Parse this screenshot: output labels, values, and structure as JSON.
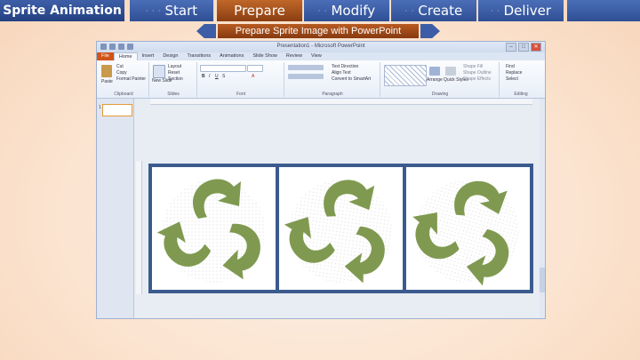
{
  "nav": {
    "title": "Sprite Animation",
    "tabs": [
      {
        "label": "Start",
        "active": false
      },
      {
        "label": "Prepare",
        "active": true
      },
      {
        "label": "Modify",
        "active": false
      },
      {
        "label": "Create",
        "active": false
      },
      {
        "label": "Deliver",
        "active": false
      }
    ]
  },
  "subtitle": "Prepare Sprite Image with PowerPoint",
  "ppt": {
    "window_title": "Presentation1 - Microsoft PowerPoint",
    "ribbon_tabs": [
      "File",
      "Home",
      "Insert",
      "Design",
      "Transitions",
      "Animations",
      "Slide Show",
      "Review",
      "View"
    ],
    "clipboard": {
      "paste": "Paste",
      "cut": "Cut",
      "copy": "Copy",
      "format_painter": "Format Painter",
      "group": "Clipboard"
    },
    "slides": {
      "new_slide": "New Slide",
      "layout": "Layout",
      "reset": "Reset",
      "section": "Section",
      "group": "Slides"
    },
    "groups": {
      "font": "Font",
      "paragraph": "Paragraph",
      "drawing": "Drawing",
      "editing": "Editing"
    },
    "paragraph_items": [
      "Text Direction",
      "Align Text",
      "Convert to SmartArt"
    ],
    "drawing_items": [
      "Arrange",
      "Quick Styles",
      "Shape Fill",
      "Shape Outline",
      "Shape Effects"
    ],
    "editing_items": [
      "Find",
      "Replace",
      "Select"
    ],
    "slide_number": "1"
  },
  "colors": {
    "nav_blue": "#3a5ba3",
    "nav_active": "#a9501c",
    "recycle_green": "#7f9a50",
    "slide_border": "#3b5b8e"
  },
  "sprite_frames": 3
}
